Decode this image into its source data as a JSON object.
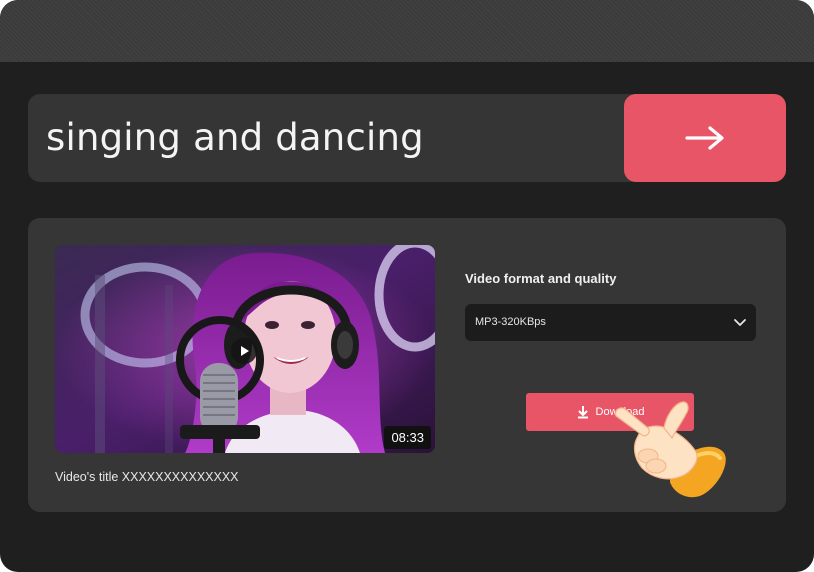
{
  "search": {
    "query": "singing and dancing",
    "go_icon": "arrow-right-icon"
  },
  "video": {
    "duration": "08:33",
    "title": "Video's title XXXXXXXXXXXXXX",
    "play_icon": "play-icon"
  },
  "options": {
    "format_label": "Video format and quality",
    "format_selected": "MP3-320KBps",
    "dropdown_icon": "chevron-down-icon",
    "download_label": "Download",
    "download_icon": "download-icon"
  },
  "colors": {
    "accent": "#e85566",
    "background": "#1f1f1f",
    "panel": "#363636"
  }
}
